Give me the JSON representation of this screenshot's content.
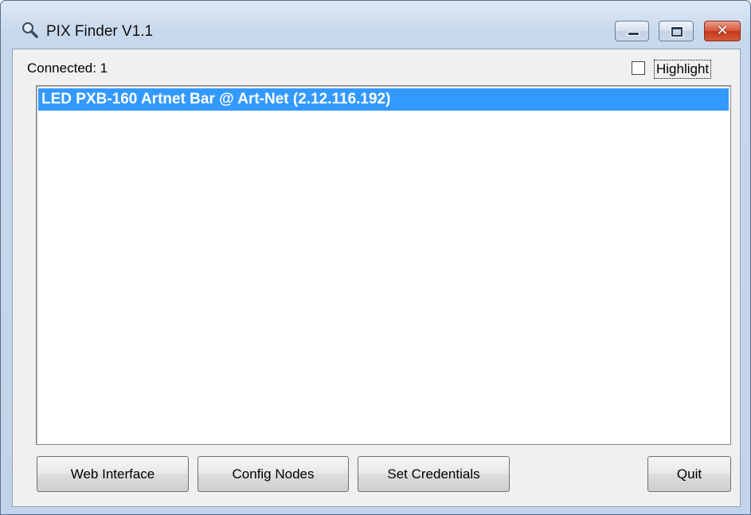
{
  "window": {
    "title": "PIX Finder V1.1",
    "icon": "magnifier-icon",
    "close_glyph": "✕"
  },
  "status": {
    "connected": "Connected: 1"
  },
  "options": {
    "highlight_label": "Highlight",
    "highlight_checked": false
  },
  "devices": [
    {
      "label": "LED PXB-160 Artnet Bar @ Art-Net (2.12.116.192)",
      "selected": true
    }
  ],
  "buttons": {
    "web_interface": "Web Interface",
    "config_nodes": "Config Nodes",
    "set_credentials": "Set Credentials",
    "quit": "Quit"
  },
  "colors": {
    "selection": "#3399ff",
    "close_button": "#c4371a"
  }
}
